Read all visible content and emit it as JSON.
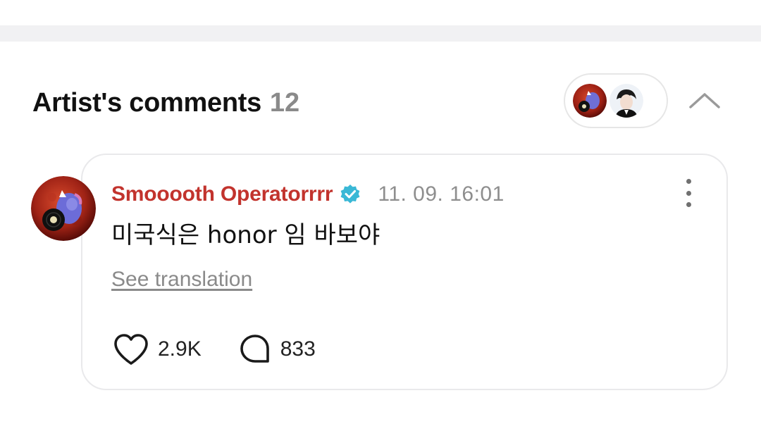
{
  "section": {
    "title": "Artist's comments",
    "count": "12"
  },
  "comment": {
    "author": "Smooooth Operatorrrr",
    "timestamp": "11. 09. 16:01",
    "text": "미국식은 honor 임 바보야",
    "see_translation": "See translation",
    "likes": "2.9K",
    "replies": "833"
  },
  "colors": {
    "author": "#c2332d",
    "verified": "#3ab8d6",
    "muted": "#8a8a8a",
    "band": "#f1f1f3",
    "card_border": "#e9e9eb"
  },
  "icons": {
    "collapse": "chevron-up-icon",
    "verified": "verified-check-icon",
    "more": "more-vertical-icon",
    "like": "heart-icon",
    "reply": "chat-bubble-icon"
  }
}
